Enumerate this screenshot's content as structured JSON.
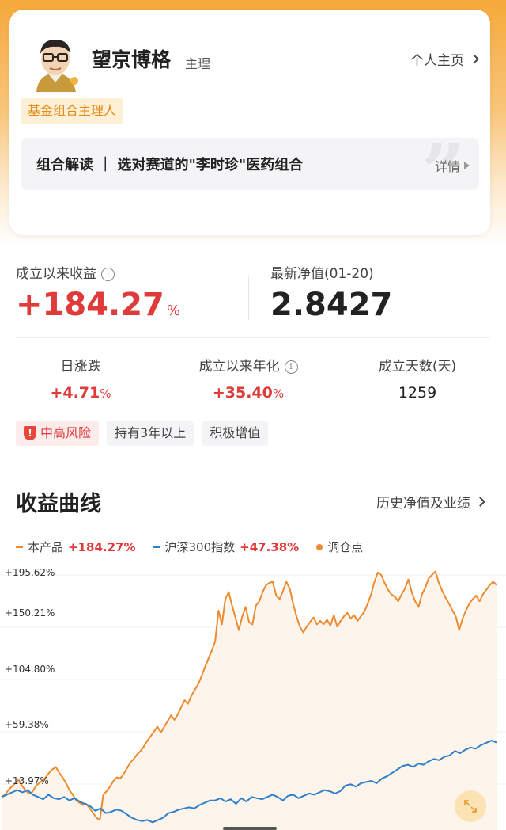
{
  "manager": {
    "name": "望京博格",
    "role": "主理",
    "profile_link": "个人主页",
    "badge": "基金组合主理人",
    "interpretation": "组合解读 ｜ 选对赛道的\"李时珍\"医药组合",
    "detail_link": "详情"
  },
  "stats": {
    "since_inception_label": "成立以来收益",
    "since_inception_value": "+184.27",
    "pct": "%",
    "nav_label": "最新净值(01-20)",
    "nav_value": "2.8427",
    "daily_label": "日涨跌",
    "daily_value": "+4.71",
    "annualized_label": "成立以来年化",
    "annualized_value": "+35.40",
    "days_label": "成立天数(天)",
    "days_value": "1259"
  },
  "tags": [
    "中高风险",
    "持有3年以上",
    "积极增值"
  ],
  "section": {
    "title": "收益曲线",
    "history_link": "历史净值及业绩"
  },
  "legend": {
    "product_label": "本产品",
    "product_value": "+184.27%",
    "index_label": "沪深300指数",
    "index_value": "+47.38%",
    "rebalance_label": "调仓点"
  },
  "colors": {
    "product": "#ee8a2f",
    "index": "#2f7fc8",
    "accent_red": "#e03b3b"
  },
  "chart_data": {
    "type": "line",
    "y_ticks": [
      "+195.62%",
      "+150.21%",
      "+104.80%",
      "+59.38%",
      "+13.97%"
    ],
    "y_tick_values": [
      195.62,
      150.21,
      104.8,
      59.38,
      13.97
    ],
    "ylim": [
      -31.45,
      205
    ],
    "series": [
      {
        "name": "本产品",
        "values": [
          0,
          2,
          6,
          9,
          12,
          15,
          10,
          6,
          3,
          4,
          9,
          12,
          14,
          17,
          21,
          24,
          26,
          21,
          17,
          12,
          6,
          2,
          -3,
          -5,
          -7,
          -6,
          -10,
          -14,
          -18,
          -20,
          2,
          5,
          9,
          14,
          17,
          16,
          20,
          25,
          30,
          33,
          37,
          40,
          44,
          49,
          53,
          57,
          61,
          56,
          61,
          66,
          71,
          67,
          72,
          78,
          84,
          81,
          88,
          93,
          98,
          105,
          113,
          120,
          127,
          135,
          162,
          150,
          172,
          178,
          166,
          156,
          145,
          157,
          165,
          152,
          150,
          166,
          170,
          178,
          184,
          186,
          187,
          175,
          172,
          179,
          187,
          181,
          168,
          157,
          148,
          143,
          148,
          152,
          156,
          150,
          153,
          150,
          154,
          149,
          158,
          148,
          153,
          157,
          160,
          155,
          158,
          153,
          157,
          161,
          168,
          176,
          187,
          195,
          193,
          186,
          180,
          176,
          174,
          170,
          176,
          181,
          189,
          178,
          170,
          165,
          176,
          182,
          190,
          193,
          196,
          186,
          179,
          173,
          168,
          162,
          157,
          145,
          155,
          162,
          168,
          172,
          175,
          170,
          176,
          180,
          184,
          187,
          184.27
        ],
        "visible_points": 144
      },
      {
        "name": "沪深300指数",
        "values": [
          0,
          2,
          4,
          6,
          4,
          6,
          2,
          0,
          -2,
          2,
          -1,
          -2,
          0,
          -3,
          -1,
          -4,
          -6,
          -8,
          -12,
          -10,
          -14,
          -13,
          -11,
          -12,
          -15,
          -18,
          -20,
          -21,
          -20,
          -22,
          -20,
          -18,
          -14,
          -13,
          -11,
          -10,
          -9,
          -10,
          -7,
          -5,
          -3,
          -3,
          -1,
          -4,
          -2,
          -6,
          -1,
          -4,
          0,
          -1,
          -2,
          0,
          2,
          0,
          -3,
          1,
          2,
          -1,
          1,
          3,
          2,
          4,
          6,
          5,
          3,
          5,
          10,
          11,
          9,
          12,
          13,
          14,
          12,
          16,
          18,
          21,
          24,
          27,
          28,
          26,
          29,
          28,
          31,
          33,
          32,
          35,
          36,
          40,
          38,
          41,
          43,
          42,
          45,
          47,
          49,
          47.38
        ],
        "visible_points": 96
      }
    ]
  }
}
